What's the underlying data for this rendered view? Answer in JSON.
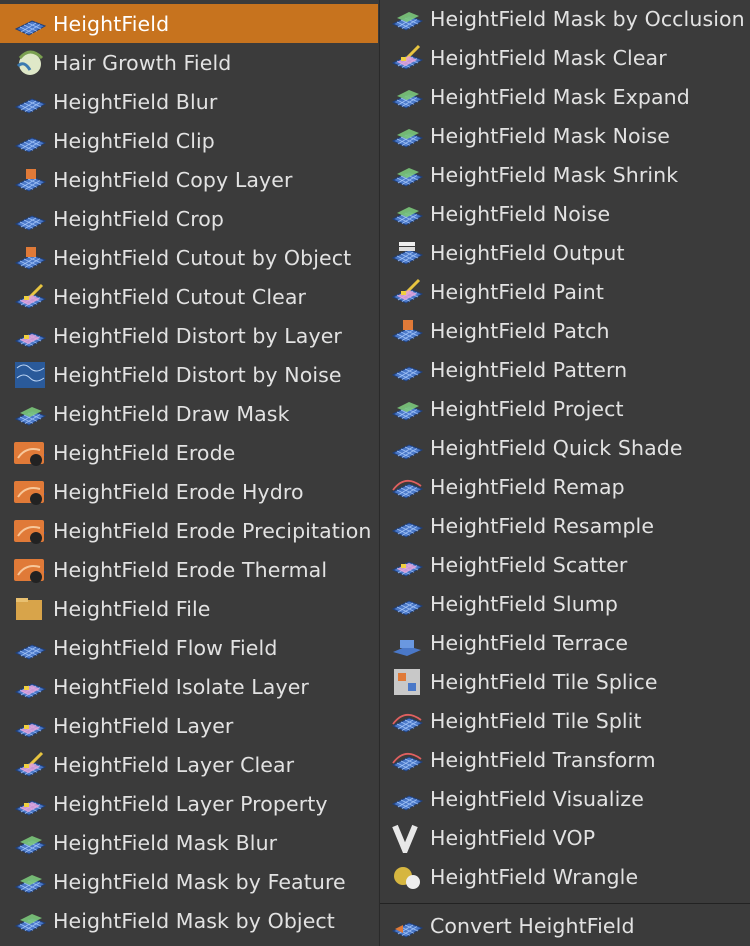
{
  "menu_left": [
    {
      "label": "HeightField",
      "icon": "heightfield-icon",
      "selected": true
    },
    {
      "label": "Hair Growth Field",
      "icon": "hair-growth-field-icon"
    },
    {
      "label": "HeightField Blur",
      "icon": "heightfield-blur-icon"
    },
    {
      "label": "HeightField Clip",
      "icon": "heightfield-clip-icon"
    },
    {
      "label": "HeightField Copy Layer",
      "icon": "heightfield-copy-layer-icon"
    },
    {
      "label": "HeightField Crop",
      "icon": "heightfield-crop-icon"
    },
    {
      "label": "HeightField Cutout by Object",
      "icon": "heightfield-cutout-by-object-icon"
    },
    {
      "label": "HeightField Cutout Clear",
      "icon": "heightfield-cutout-clear-icon"
    },
    {
      "label": "HeightField Distort by Layer",
      "icon": "heightfield-distort-by-layer-icon"
    },
    {
      "label": "HeightField Distort by Noise",
      "icon": "heightfield-distort-by-noise-icon"
    },
    {
      "label": "HeightField Draw Mask",
      "icon": "heightfield-draw-mask-icon"
    },
    {
      "label": "HeightField Erode",
      "icon": "heightfield-erode-icon"
    },
    {
      "label": "HeightField Erode Hydro",
      "icon": "heightfield-erode-hydro-icon"
    },
    {
      "label": "HeightField Erode Precipitation",
      "icon": "heightfield-erode-precipitation-icon"
    },
    {
      "label": "HeightField Erode Thermal",
      "icon": "heightfield-erode-thermal-icon"
    },
    {
      "label": "HeightField File",
      "icon": "heightfield-file-icon"
    },
    {
      "label": "HeightField Flow Field",
      "icon": "heightfield-flow-field-icon"
    },
    {
      "label": "HeightField Isolate Layer",
      "icon": "heightfield-isolate-layer-icon"
    },
    {
      "label": "HeightField Layer",
      "icon": "heightfield-layer-icon"
    },
    {
      "label": "HeightField Layer Clear",
      "icon": "heightfield-layer-clear-icon"
    },
    {
      "label": "HeightField Layer Property",
      "icon": "heightfield-layer-property-icon"
    },
    {
      "label": "HeightField Mask Blur",
      "icon": "heightfield-mask-blur-icon"
    },
    {
      "label": "HeightField Mask by Feature",
      "icon": "heightfield-mask-by-feature-icon"
    },
    {
      "label": "HeightField Mask by Object",
      "icon": "heightfield-mask-by-object-icon"
    }
  ],
  "menu_right": [
    {
      "label": "HeightField Mask by Occlusion",
      "icon": "heightfield-mask-by-occlusion-icon"
    },
    {
      "label": "HeightField Mask Clear",
      "icon": "heightfield-mask-clear-icon"
    },
    {
      "label": "HeightField Mask Expand",
      "icon": "heightfield-mask-expand-icon"
    },
    {
      "label": "HeightField Mask Noise",
      "icon": "heightfield-mask-noise-icon"
    },
    {
      "label": "HeightField Mask Shrink",
      "icon": "heightfield-mask-shrink-icon"
    },
    {
      "label": "HeightField Noise",
      "icon": "heightfield-noise-icon"
    },
    {
      "label": "HeightField Output",
      "icon": "heightfield-output-icon"
    },
    {
      "label": "HeightField Paint",
      "icon": "heightfield-paint-icon"
    },
    {
      "label": "HeightField Patch",
      "icon": "heightfield-patch-icon"
    },
    {
      "label": "HeightField Pattern",
      "icon": "heightfield-pattern-icon"
    },
    {
      "label": "HeightField Project",
      "icon": "heightfield-project-icon"
    },
    {
      "label": "HeightField Quick Shade",
      "icon": "heightfield-quick-shade-icon"
    },
    {
      "label": "HeightField Remap",
      "icon": "heightfield-remap-icon"
    },
    {
      "label": "HeightField Resample",
      "icon": "heightfield-resample-icon"
    },
    {
      "label": "HeightField Scatter",
      "icon": "heightfield-scatter-icon"
    },
    {
      "label": "HeightField Slump",
      "icon": "heightfield-slump-icon"
    },
    {
      "label": "HeightField Terrace",
      "icon": "heightfield-terrace-icon"
    },
    {
      "label": "HeightField Tile Splice",
      "icon": "heightfield-tile-splice-icon"
    },
    {
      "label": "HeightField Tile Split",
      "icon": "heightfield-tile-split-icon"
    },
    {
      "label": "HeightField Transform",
      "icon": "heightfield-transform-icon"
    },
    {
      "label": "HeightField Visualize",
      "icon": "heightfield-visualize-icon"
    },
    {
      "label": "HeightField VOP",
      "icon": "heightfield-vop-icon"
    },
    {
      "label": "HeightField Wrangle",
      "icon": "heightfield-wrangle-icon"
    }
  ],
  "menu_footer": {
    "label": "Convert HeightField",
    "icon": "convert-heightfield-icon"
  },
  "colors": {
    "selected_bg": "#c7731e",
    "menu_bg": "#3b3b3b",
    "text": "#e2e2e2",
    "grid_blue": "#4a78c8"
  }
}
